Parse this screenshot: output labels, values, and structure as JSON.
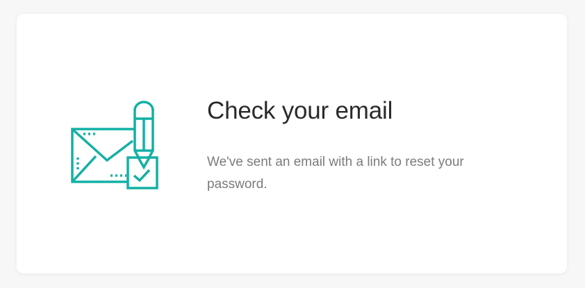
{
  "card": {
    "icon": "envelope-pencil-check-icon",
    "accent_color": "#13b0a5",
    "title": "Check your email",
    "message": "We've sent an email with a link to reset your password."
  }
}
